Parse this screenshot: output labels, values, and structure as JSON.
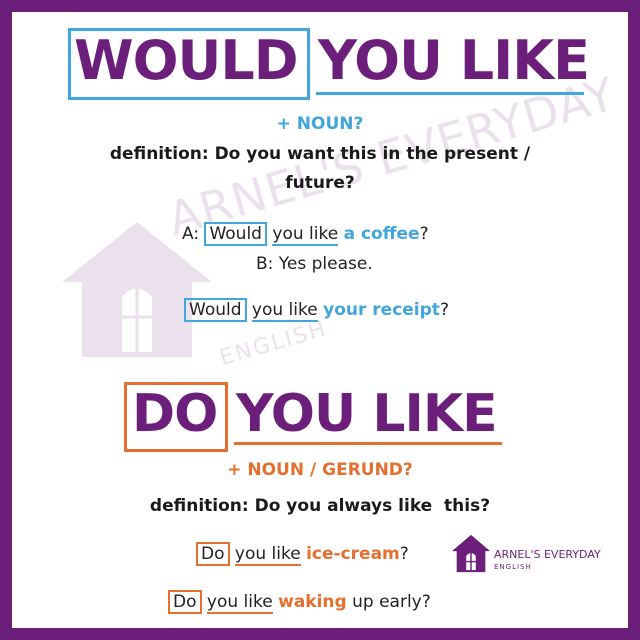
{
  "watermark": {
    "brand": "ARNEL'S EVERYDAY",
    "sub": "ENGLISH"
  },
  "section1": {
    "word_boxed": "WOULD",
    "word_rest": "YOU LIKE",
    "grammar": "+ NOUN?",
    "definition_line1": "definition: Do you want this in the present /",
    "definition_line2": "future?",
    "example_a": {
      "prefix": "A:",
      "boxed": "Would",
      "mid": "you like",
      "highlight": "a coffee",
      "end": "?"
    },
    "example_b": "B: Yes please.",
    "example_c": {
      "boxed": "Would",
      "mid": "you like",
      "highlight": "your receipt",
      "end": "?"
    }
  },
  "section2": {
    "word_boxed": "DO",
    "word_rest": "YOU LIKE",
    "grammar": "+ NOUN / GERUND?",
    "definition": "definition: Do you always like  this?",
    "example_a": {
      "boxed": "Do",
      "mid": "you like",
      "highlight": "ice-cream",
      "end": "?"
    },
    "example_b": {
      "boxed": "Do",
      "mid": "you like",
      "highlight": "waking",
      "end": "up early?"
    }
  },
  "logo": {
    "name": "ARNEL'S EVERYDAY",
    "sub": "ENGLISH"
  },
  "colors": {
    "purple": "#6b1f7a",
    "blue": "#41a6dc",
    "orange": "#e56f2e"
  }
}
